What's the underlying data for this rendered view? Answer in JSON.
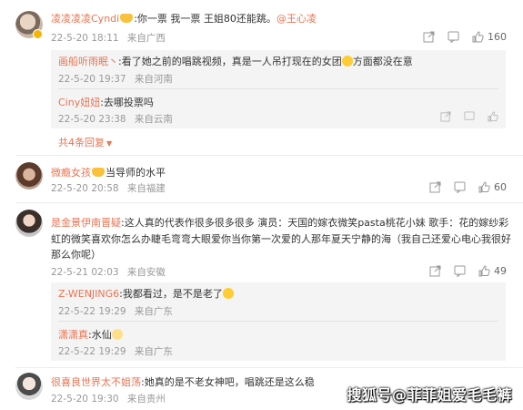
{
  "comments": [
    {
      "user": "凌凌凌凌Cyndi",
      "text": ":你一票 我一票 王姐80还能跳。",
      "mention": "@王心凌",
      "date": "22-5-20 18:11",
      "location": "来自广西",
      "likes": "160",
      "replies": [
        {
          "user": "画船听雨眠丶",
          "text": ":看了她之前的唱跳视频，真是一人吊打现在的女团",
          "text2": "方面都没在意",
          "date": "22-5-20 19:37",
          "location": "来自河南"
        },
        {
          "user": "Ciny妞妞",
          "text": ":去哪投票吗",
          "date": "22-5-20 23:38",
          "location": "来自云南"
        }
      ],
      "more_label": "共4条回复"
    },
    {
      "user": "微瘾女孩",
      "text": "当导师的水平",
      "date": "22-5-20 20:58",
      "location": "来自福建",
      "likes": "60"
    },
    {
      "user": "是金景伊南晋疑",
      "text_line1": ":这人真的代表作很多很多很多 演员：天国的嫁衣微笑pasta桃花小妹 歌手：花的嫁纱彩",
      "text_line2": "虹的微笑喜欢你怎么办睫毛弯弯大眼爱你当你第一次爱的人那年夏天宁静的海（我自己还爱心电心我很好",
      "text_line3": "那么你呢）",
      "date": "22-5-21 02:03",
      "location": "来自安徽",
      "likes": "49",
      "replies": [
        {
          "user": "Z-WENJING6",
          "text": ":我都看过，是不是老了",
          "date": "22-5-22 19:29",
          "location": "来自广东"
        },
        {
          "user": "潇潇真",
          "text": ":水仙",
          "date": "22-5-22 19:29",
          "location": "来自广东"
        }
      ]
    },
    {
      "user": "很喜良世界太不姐荡",
      "text": ":她真的是不老女神吧，唱跳还是这么稳",
      "date": "22-5-20 19:30",
      "location": "来自贵州"
    }
  ],
  "watermark": "搜狐号@菲菲姐爱毛毛裤",
  "colors": {
    "accent": "#eb7350",
    "meta": "#999999",
    "reply_bg": "#f4f4f4"
  }
}
